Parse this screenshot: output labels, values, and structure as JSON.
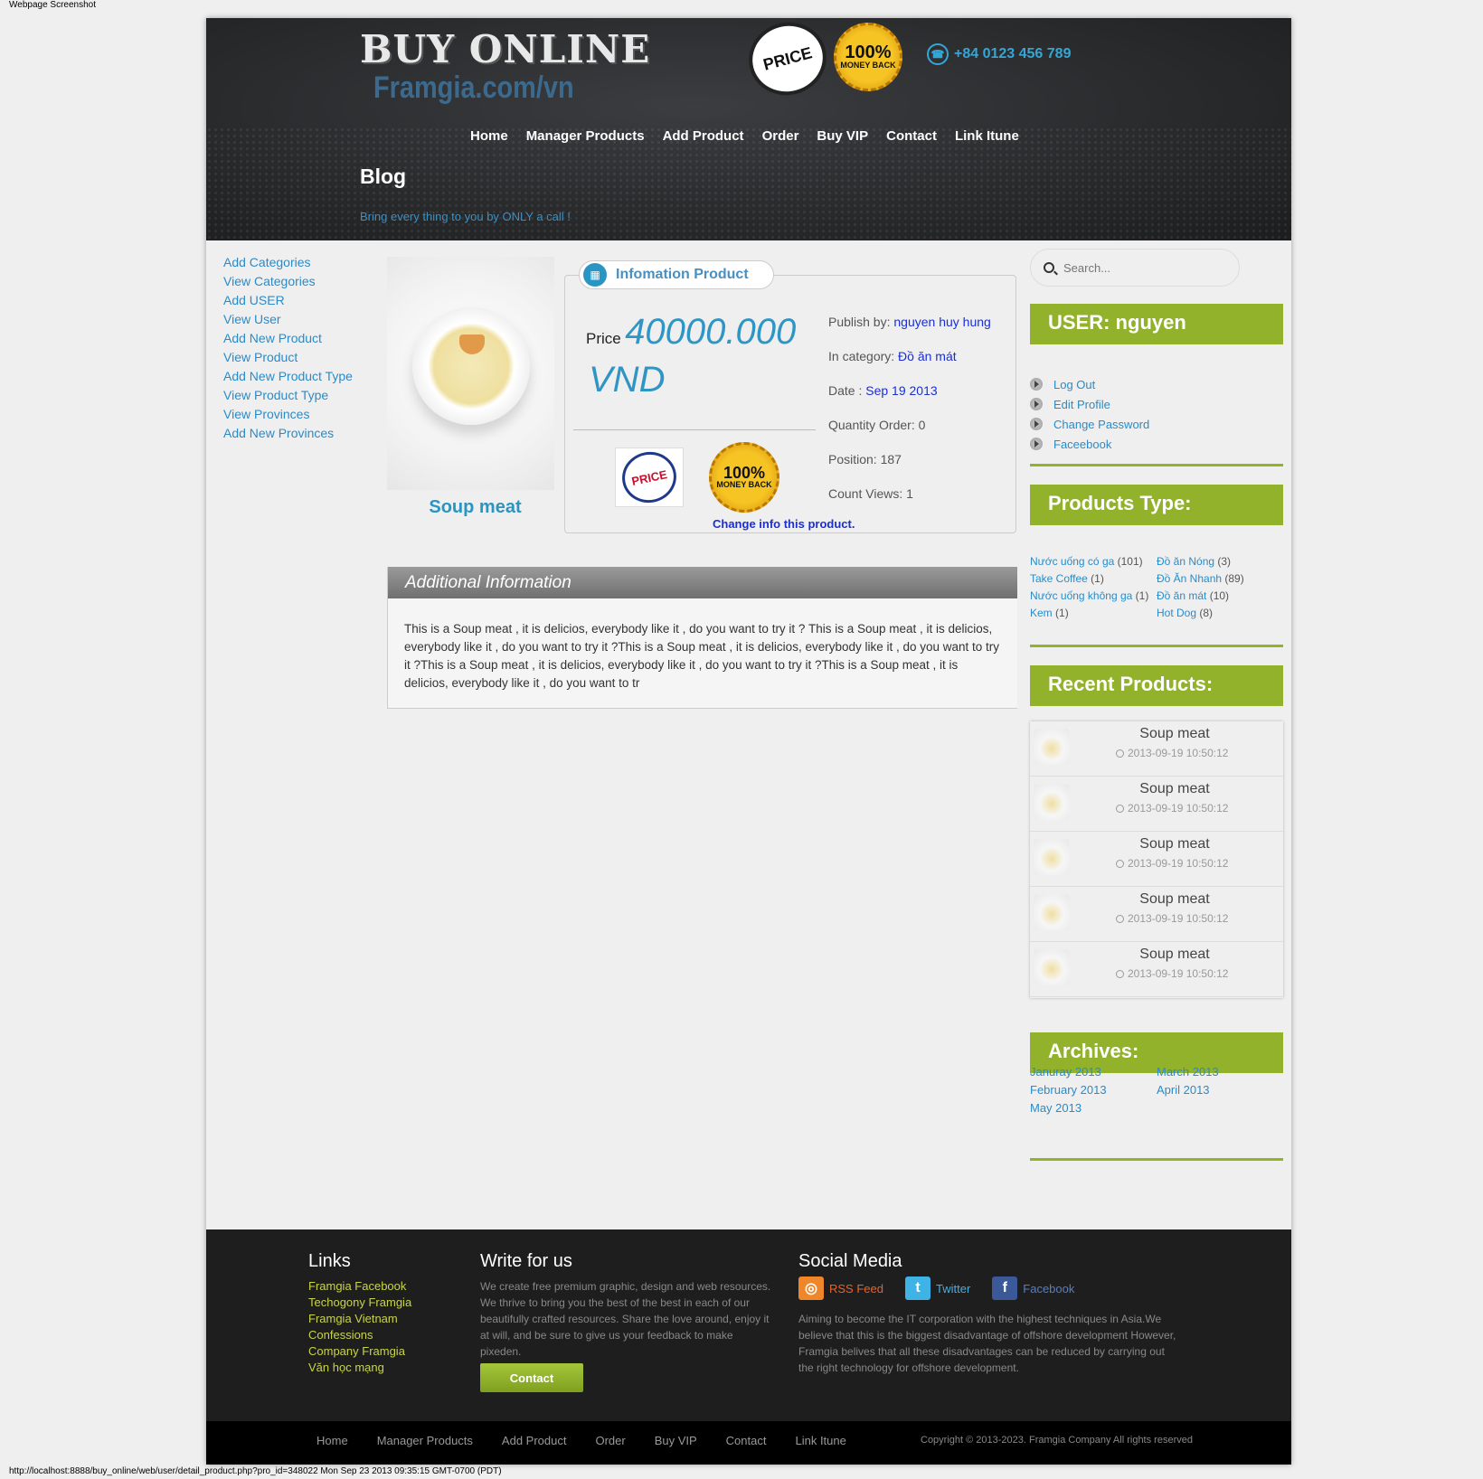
{
  "screenshot_title": "Webpage Screenshot",
  "status_url": "http://localhost:8888/buy_online/web/user/detail_product.php?pro_id=348022 Mon Sep 23 2013 09:35:15 GMT-0700 (PDT)",
  "header": {
    "logo_main": "BUY ONLINE",
    "logo_sub": "Framgia.com/vn",
    "seal_price": "PRICE",
    "seal_money_top": "100%",
    "seal_money_bottom": "MONEY BACK",
    "phone": "+84 0123 456 789",
    "blog_title": "Blog",
    "blog_subtitle": "Bring every thing to you by ONLY a call !"
  },
  "nav": [
    "Home",
    "Manager Products",
    "Add Product",
    "Order",
    "Buy VIP",
    "Contact",
    "Link Itune"
  ],
  "left_menu": [
    "Add Categories",
    "View Categories",
    "Add USER",
    "View User",
    "Add New Product",
    "View Product",
    "Add New Product Type",
    "View Product Type",
    "View Provinces",
    "Add New Provinces"
  ],
  "product": {
    "name": "Soup meat",
    "info_tab_label": "Infomation Product",
    "price_label": "Price",
    "price_value": "40000.000",
    "price_currency": "VND",
    "change_link": "Change info this product.",
    "publish_label": "Publish by:",
    "publish_value": "nguyen huy hung",
    "category_label": "In category:",
    "category_value": "Đồ ăn mát",
    "date_label": "Date :",
    "date_value": "Sep 19 2013",
    "quantity": "Quantity Order: 0",
    "position": "Position: 187",
    "views": "Count Views: 1"
  },
  "additional": {
    "title": "Additional Information",
    "body": "This is a Soup meat , it is delicios, everybody like it , do you want to try it ? This is a Soup meat , it is delicios, everybody like it , do you want to try it ?This is a Soup meat , it is delicios, everybody like it , do you want to try it ?This is a Soup meat , it is delicios, everybody like it , do you want to try it ?This is a Soup meat , it is delicios, everybody like it , do you want to tr"
  },
  "sidebar": {
    "search_placeholder": "Search...",
    "user_title": "USER: nguyen",
    "user_links": [
      "Log Out",
      "Edit Profile",
      "Change Password",
      "Faceebook"
    ],
    "types_title": "Products Type:",
    "types": [
      {
        "name": "Nước uống có ga",
        "count": "(101)"
      },
      {
        "name": "Đồ ăn Nóng",
        "count": "(3)"
      },
      {
        "name": "Take Coffee",
        "count": "(1)"
      },
      {
        "name": "Đồ Ăn Nhanh",
        "count": "(89)"
      },
      {
        "name": "Nước uống không ga",
        "count": "(1)"
      },
      {
        "name": "Đồ ăn mát",
        "count": "(10)"
      },
      {
        "name": "Kem",
        "count": "(1)"
      },
      {
        "name": "Hot Dog",
        "count": "(8)"
      }
    ],
    "recent_title": "Recent Products:",
    "recent": [
      {
        "name": "Soup meat",
        "date": "2013-09-19 10:50:12"
      },
      {
        "name": "Soup meat",
        "date": "2013-09-19 10:50:12"
      },
      {
        "name": "Soup meat",
        "date": "2013-09-19 10:50:12"
      },
      {
        "name": "Soup meat",
        "date": "2013-09-19 10:50:12"
      },
      {
        "name": "Soup meat",
        "date": "2013-09-19 10:50:12"
      }
    ],
    "archives_title": "Archives:",
    "archives": [
      "Januray 2013",
      "March 2013",
      "February 2013",
      "April 2013",
      "May 2013"
    ]
  },
  "footer": {
    "links_title": "Links",
    "links": [
      "Framgia Facebook",
      "Techogony Framgia",
      "Framgia Vietnam",
      "Confessions",
      "Company Framgia",
      "Văn học mạng"
    ],
    "write_title": "Write for us",
    "write_text": "We create free premium graphic, design and web resources. We thrive to bring you the best of the best in each of our beautifully crafted resources. Share the love around, enjoy it at will, and be sure to give us your feedback to make pixeden.",
    "contact_button": "Contact",
    "social_title": "Social Media",
    "rss": "RSS Feed",
    "twitter": "Twitter",
    "facebook": "Facebook",
    "about": "Aiming to become the IT corporation with the highest techniques in Asia.We believe that this is the biggest disadvantage of offshore development However, Framgia belives that all these disadvantages can be reduced by carrying out the right technology for offshore development.",
    "copyright": "Copyright © 2013-2023. Framgia Company All rights reserved"
  },
  "colors": {
    "accent_green": "#93b22c",
    "link_blue": "#2a8bc8",
    "header_dark": "#2a2b2d"
  }
}
